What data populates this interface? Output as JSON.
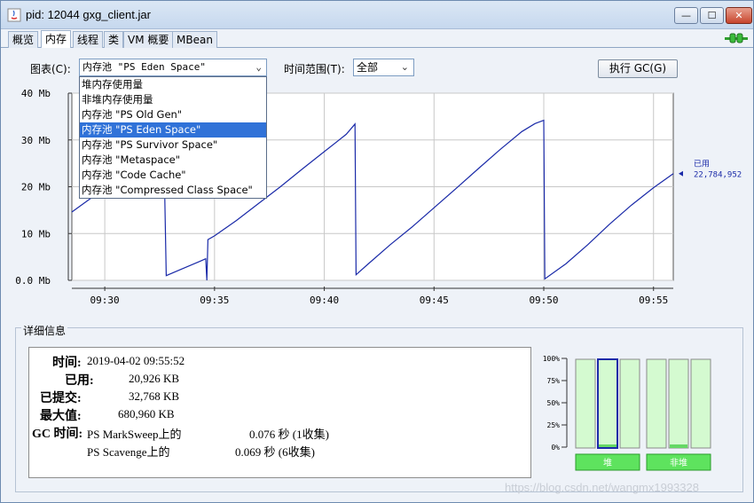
{
  "window": {
    "title": "pid: 12044 gxg_client.jar",
    "minimize": "—",
    "maximize": "☐",
    "close": "✕"
  },
  "tabs": [
    "概览",
    "内存",
    "线程",
    "类",
    "VM 概要",
    "MBean"
  ],
  "toolbar": {
    "chart_label": "图表(C):",
    "chart_value": "内存池 \"PS Eden Space\"",
    "time_label": "时间范围(T):",
    "time_value": "全部",
    "gc_button": "执行 GC(G)"
  },
  "dropdown_options": [
    "堆内存使用量",
    "非堆内存使用量",
    "内存池 \"PS Old Gen\"",
    "内存池 \"PS Eden Space\"",
    "内存池 \"PS Survivor Space\"",
    "内存池 \"Metaspace\"",
    "内存池 \"Code Cache\"",
    "内存池 \"Compressed Class Space\""
  ],
  "chart_data": {
    "type": "line",
    "y_ticks": [
      "40 Mb",
      "30 Mb",
      "20 Mb",
      "10 Mb",
      "0.0 Mb"
    ],
    "y_values": [
      40,
      30,
      20,
      10,
      0
    ],
    "x_ticks": [
      "09:30",
      "09:35",
      "09:40",
      "09:45",
      "09:50",
      "09:55"
    ],
    "x_minutes": [
      30,
      35,
      40,
      45,
      50,
      55
    ],
    "xlim": [
      28.5,
      55.9
    ],
    "ylim": [
      0,
      40
    ],
    "grid": true,
    "series": [
      {
        "name": "已用",
        "color": "#1a2aa8",
        "points": [
          [
            28.5,
            14.6
          ],
          [
            29.0,
            16.3
          ],
          [
            29.5,
            18.0
          ],
          [
            30.0,
            19.7
          ],
          [
            30.5,
            21.4
          ],
          [
            31.0,
            23.0
          ],
          [
            31.5,
            24.5
          ],
          [
            32.0,
            25.7
          ],
          [
            32.6,
            26.6
          ],
          [
            32.7,
            26.6
          ],
          [
            32.8,
            1.0
          ],
          [
            33.5,
            2.4
          ],
          [
            34.3,
            4.0
          ],
          [
            34.6,
            4.6
          ],
          [
            34.65,
            0.0
          ],
          [
            34.7,
            8.7
          ],
          [
            35.0,
            9.5
          ],
          [
            36.0,
            12.8
          ],
          [
            37.0,
            16.4
          ],
          [
            38.0,
            20.0
          ],
          [
            39.0,
            23.8
          ],
          [
            40.0,
            27.5
          ],
          [
            41.0,
            31.2
          ],
          [
            41.4,
            33.4
          ],
          [
            41.45,
            1.2
          ],
          [
            42.0,
            3.5
          ],
          [
            43.0,
            7.6
          ],
          [
            44.0,
            11.4
          ],
          [
            45.0,
            15.5
          ],
          [
            46.0,
            19.6
          ],
          [
            47.0,
            23.8
          ],
          [
            48.0,
            27.9
          ],
          [
            49.0,
            31.8
          ],
          [
            49.6,
            33.5
          ],
          [
            50.0,
            34.2
          ],
          [
            50.05,
            0.3
          ],
          [
            51.0,
            3.5
          ],
          [
            52.0,
            7.6
          ],
          [
            53.0,
            12.0
          ],
          [
            54.0,
            16.1
          ],
          [
            55.0,
            19.8
          ],
          [
            55.9,
            22.8
          ]
        ]
      }
    ],
    "legend_label": "已用",
    "legend_value": "22,784,952"
  },
  "details": {
    "section_title": "详细信息",
    "time_label": "时间:",
    "time_value": "2019-04-02 09:55:52",
    "used_label": "已用:",
    "used_value": "20,926 KB",
    "committed_label": "已提交:",
    "committed_value": "32,768 KB",
    "max_label": "最大值:",
    "max_value": "680,960 KB",
    "gc_label": "GC 时间:",
    "gc1_name": "PS MarkSweep上的",
    "gc1_value": "0.076 秒 (1收集)",
    "gc2_name": "PS Scavenge上的",
    "gc2_value": "0.069 秒 (6收集)"
  },
  "mini_chart": {
    "ticks": [
      "100%",
      "75%",
      "50%",
      "25%",
      "0%"
    ],
    "heap_label": "堆",
    "nonheap_label": "非堆",
    "heap_bars": [
      0.0,
      0.04,
      0.0
    ],
    "nonheap_bars": [
      0.0,
      0.04,
      0.0
    ]
  },
  "watermark": "https://blog.csdn.net/wangmx1993328"
}
